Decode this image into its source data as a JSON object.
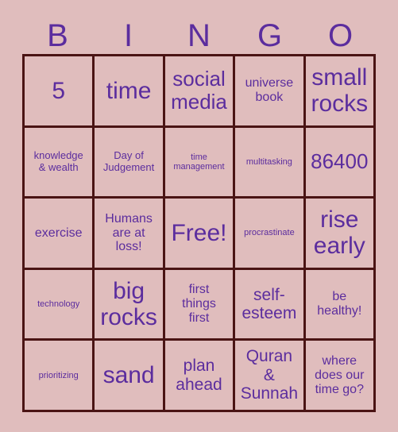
{
  "card": {
    "title": "BINGO",
    "colors": {
      "background": "#e0bdbd",
      "cell_background": "#e0bdbd",
      "border": "#4a1414",
      "text": "#5b2d9e"
    },
    "header": {
      "letters": [
        {
          "label": "B"
        },
        {
          "label": "I"
        },
        {
          "label": "N"
        },
        {
          "label": "G"
        },
        {
          "label": "O"
        }
      ]
    },
    "free_space": "Free!",
    "rows": [
      {
        "cells": [
          {
            "label": "5",
            "size": "xl"
          },
          {
            "label": "time",
            "size": "xl"
          },
          {
            "label": "social\nmedia",
            "size": "lg"
          },
          {
            "label": "universe\nbook",
            "size": "sm"
          },
          {
            "label": "small\nrocks",
            "size": "xl"
          }
        ]
      },
      {
        "cells": [
          {
            "label": "knowledge\n& wealth",
            "size": "xs"
          },
          {
            "label": "Day of\nJudgement",
            "size": "xs"
          },
          {
            "label": "time\nmanagement",
            "size": "xxs"
          },
          {
            "label": "multitasking",
            "size": "xxs"
          },
          {
            "label": "86400",
            "size": "lg"
          }
        ]
      },
      {
        "cells": [
          {
            "label": "exercise",
            "size": "sm"
          },
          {
            "label": "Humans\nare at\nloss!",
            "size": "sm"
          },
          {
            "label": "Free!",
            "size": "xl"
          },
          {
            "label": "procrastinate",
            "size": "xxs"
          },
          {
            "label": "rise\nearly",
            "size": "xl"
          }
        ]
      },
      {
        "cells": [
          {
            "label": "technology",
            "size": "xxs"
          },
          {
            "label": "big\nrocks",
            "size": "xl"
          },
          {
            "label": "first\nthings\nfirst",
            "size": "sm"
          },
          {
            "label": "self-\nesteem",
            "size": "md"
          },
          {
            "label": "be\nhealthy!",
            "size": "sm"
          }
        ]
      },
      {
        "cells": [
          {
            "label": "prioritizing",
            "size": "xxs"
          },
          {
            "label": "sand",
            "size": "xl"
          },
          {
            "label": "plan\nahead",
            "size": "md"
          },
          {
            "label": "Quran\n&\nSunnah",
            "size": "md"
          },
          {
            "label": "where\ndoes our\ntime go?",
            "size": "sm"
          }
        ]
      }
    ]
  }
}
